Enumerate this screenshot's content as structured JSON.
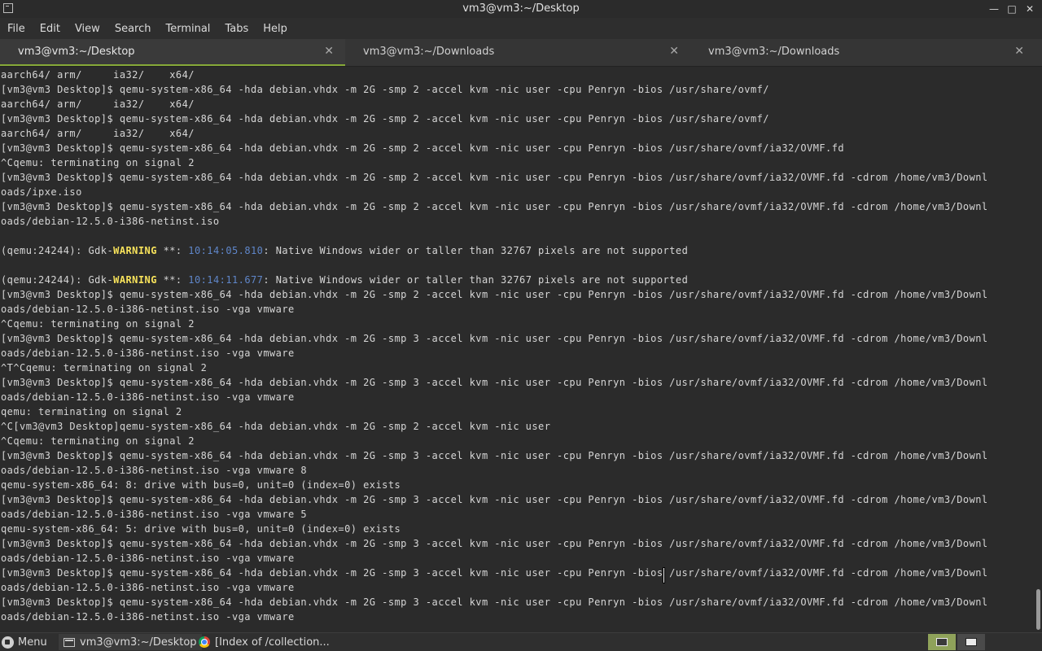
{
  "window": {
    "title": "vm3@vm3:~/Desktop",
    "controls": {
      "minimize": "—",
      "maximize": "□",
      "close": "✕"
    }
  },
  "menubar": {
    "items": [
      {
        "label": "File"
      },
      {
        "label": "Edit"
      },
      {
        "label": "View"
      },
      {
        "label": "Search"
      },
      {
        "label": "Terminal"
      },
      {
        "label": "Tabs"
      },
      {
        "label": "Help"
      }
    ]
  },
  "tabs": [
    {
      "label": "vm3@vm3:~/Desktop",
      "active": true,
      "close": "✕"
    },
    {
      "label": "vm3@vm3:~/Downloads",
      "active": false,
      "close": "✕"
    },
    {
      "label": "vm3@vm3:~/Downloads",
      "active": false,
      "close": "✕"
    }
  ],
  "terminal": {
    "lines": [
      "aarch64/ arm/     ia32/    x64/",
      "[vm3@vm3 Desktop]$ qemu-system-x86_64 -hda debian.vhdx -m 2G -smp 2 -accel kvm -nic user -cpu Penryn -bios /usr/share/ovmf/",
      "aarch64/ arm/     ia32/    x64/",
      "[vm3@vm3 Desktop]$ qemu-system-x86_64 -hda debian.vhdx -m 2G -smp 2 -accel kvm -nic user -cpu Penryn -bios /usr/share/ovmf/",
      "aarch64/ arm/     ia32/    x64/",
      "[vm3@vm3 Desktop]$ qemu-system-x86_64 -hda debian.vhdx -m 2G -smp 2 -accel kvm -nic user -cpu Penryn -bios /usr/share/ovmf/ia32/OVMF.fd",
      "^Cqemu: terminating on signal 2",
      "[vm3@vm3 Desktop]$ qemu-system-x86_64 -hda debian.vhdx -m 2G -smp 2 -accel kvm -nic user -cpu Penryn -bios /usr/share/ovmf/ia32/OVMF.fd -cdrom /home/vm3/Downl",
      "oads/ipxe.iso",
      "[vm3@vm3 Desktop]$ qemu-system-x86_64 -hda debian.vhdx -m 2G -smp 2 -accel kvm -nic user -cpu Penryn -bios /usr/share/ovmf/ia32/OVMF.fd -cdrom /home/vm3/Downl",
      "oads/debian-12.5.0-i386-netinst.iso",
      "",
      "__WARN1__",
      "",
      "__WARN2__",
      "[vm3@vm3 Desktop]$ qemu-system-x86_64 -hda debian.vhdx -m 2G -smp 2 -accel kvm -nic user -cpu Penryn -bios /usr/share/ovmf/ia32/OVMF.fd -cdrom /home/vm3/Downl",
      "oads/debian-12.5.0-i386-netinst.iso -vga vmware",
      "^Cqemu: terminating on signal 2",
      "[vm3@vm3 Desktop]$ qemu-system-x86_64 -hda debian.vhdx -m 2G -smp 3 -accel kvm -nic user -cpu Penryn -bios /usr/share/ovmf/ia32/OVMF.fd -cdrom /home/vm3/Downl",
      "oads/debian-12.5.0-i386-netinst.iso -vga vmware",
      "^T^Cqemu: terminating on signal 2",
      "[vm3@vm3 Desktop]$ qemu-system-x86_64 -hda debian.vhdx -m 2G -smp 3 -accel kvm -nic user -cpu Penryn -bios /usr/share/ovmf/ia32/OVMF.fd -cdrom /home/vm3/Downl",
      "oads/debian-12.5.0-i386-netinst.iso -vga vmware",
      "qemu: terminating on signal 2",
      "^C[vm3@vm3 Desktop]qemu-system-x86_64 -hda debian.vhdx -m 2G -smp 2 -accel kvm -nic user",
      "^Cqemu: terminating on signal 2",
      "[vm3@vm3 Desktop]$ qemu-system-x86_64 -hda debian.vhdx -m 2G -smp 3 -accel kvm -nic user -cpu Penryn -bios /usr/share/ovmf/ia32/OVMF.fd -cdrom /home/vm3/Downl",
      "oads/debian-12.5.0-i386-netinst.iso -vga vmware 8",
      "qemu-system-x86_64: 8: drive with bus=0, unit=0 (index=0) exists",
      "[vm3@vm3 Desktop]$ qemu-system-x86_64 -hda debian.vhdx -m 2G -smp 3 -accel kvm -nic user -cpu Penryn -bios /usr/share/ovmf/ia32/OVMF.fd -cdrom /home/vm3/Downl",
      "oads/debian-12.5.0-i386-netinst.iso -vga vmware 5",
      "qemu-system-x86_64: 5: drive with bus=0, unit=0 (index=0) exists",
      "[vm3@vm3 Desktop]$ qemu-system-x86_64 -hda debian.vhdx -m 2G -smp 3 -accel kvm -nic user -cpu Penryn -bios /usr/share/ovmf/ia32/OVMF.fd -cdrom /home/vm3/Downl",
      "oads/debian-12.5.0-i386-netinst.iso -vga vmware",
      "[vm3@vm3 Desktop]$ qemu-system-x86_64 -hda debian.vhdx -m 2G -smp 3 -accel kvm -nic user -cpu Penryn -bios /usr/share/ovmf/ia32/OVMF.fd -cdrom /home/vm3/Downl",
      "oads/debian-12.5.0-i386-netinst.iso -vga vmware",
      "[vm3@vm3 Desktop]$ qemu-system-x86_64 -hda debian.vhdx -m 2G -smp 3 -accel kvm -nic user -cpu Penryn -bios /usr/share/ovmf/ia32/OVMF.fd -cdrom /home/vm3/Downl",
      "oads/debian-12.5.0-i386-netinst.iso -vga vmware"
    ],
    "warnings": {
      "w1": {
        "prefix": "(qemu:24244): Gdk-",
        "level": "WARNING",
        "stars": " **: ",
        "time": "10:14:05.810",
        "message": ": Native Windows wider or taller than 32767 pixels are not supported"
      },
      "w2": {
        "prefix": "(qemu:24244): Gdk-",
        "level": "WARNING",
        "stars": " **: ",
        "time": "10:14:11.677",
        "message": ": Native Windows wider or taller than 32767 pixels are not supported"
      }
    }
  },
  "taskbar": {
    "menu_label": "Menu",
    "windows": [
      {
        "label": "vm3@vm3:~/Desktop",
        "icon": "terminal-icon",
        "active": true
      },
      {
        "label": "[Index of /collection...",
        "icon": "chrome-icon",
        "active": false
      }
    ]
  },
  "colors": {
    "terminal_bg": "#2b2b2b",
    "tab_accent": "#86a938",
    "warning": "#f7e25b",
    "timestamp": "#5f86c9"
  }
}
